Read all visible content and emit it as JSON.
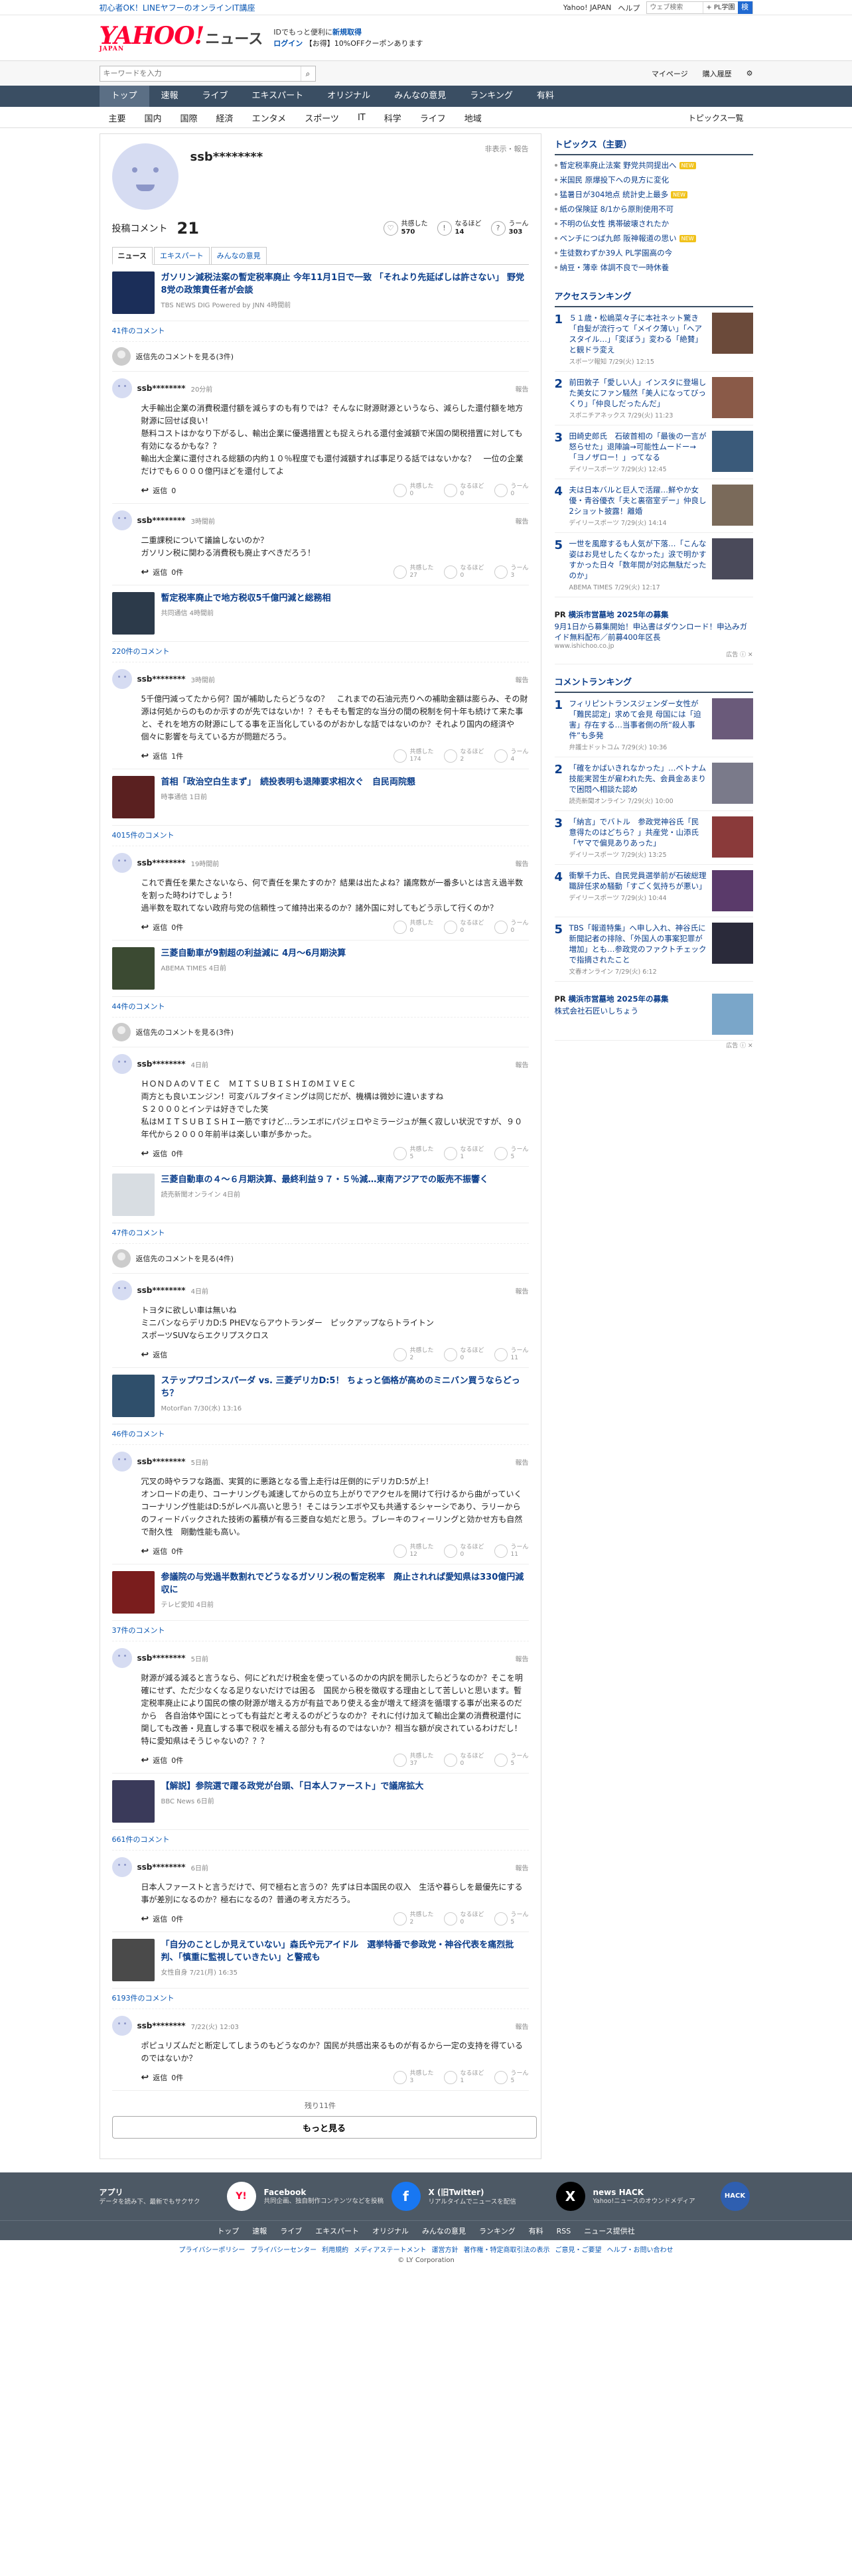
{
  "topbar": {
    "promo": "初心者OK！LINEヤフーのオンラインIT講座",
    "links": [
      "Yahoo! JAPAN",
      "ヘルプ"
    ],
    "search_placeholder": "ウェブ検索",
    "search_option": "+ PL学園",
    "search_button": "検"
  },
  "header": {
    "logo_text": "YAHOO!",
    "logo_sub": "JAPAN",
    "service": "ニュース",
    "msg1_prefix": "IDでもっと便利に",
    "msg1_link": "新規取得",
    "msg2_link": "ログイン",
    "msg2_suffix": "【お得】10%OFFクーポンあります"
  },
  "searchbar": {
    "placeholder": "キーワードを入力",
    "links": [
      "マイページ",
      "購入履歴"
    ]
  },
  "nav_main": [
    "トップ",
    "速報",
    "ライブ",
    "エキスパート",
    "オリジナル",
    "みんなの意見",
    "ランキング",
    "有料"
  ],
  "nav_sub": [
    "主要",
    "国内",
    "国際",
    "経済",
    "エンタメ",
    "スポーツ",
    "IT",
    "科学",
    "ライフ",
    "地域"
  ],
  "nav_sub_right": "トピックス一覧",
  "profile": {
    "name": "ssb********",
    "hide": "非表示・報告",
    "post_label": "投稿コメント",
    "post_count": "21",
    "reacts": [
      {
        "icon": "♡",
        "label": "共感した",
        "value": "570"
      },
      {
        "icon": "!",
        "label": "なるほど",
        "value": "14"
      },
      {
        "icon": "?",
        "label": "うーん",
        "value": "303"
      }
    ],
    "tabs": [
      "ニュース",
      "エキスパート",
      "みんなの意見"
    ]
  },
  "common": {
    "reply": "返信",
    "report": "報告",
    "react_labels": [
      "共感した",
      "なるほど",
      "うーん"
    ],
    "see_replies_prefix": "返信先のコメントを見る"
  },
  "articles": [
    {
      "title": "ガソリン減税法案の暫定税率廃止 今年11月1日で一致 「それより先延ばしは許さない」 野党8党の政策責任者が会談",
      "meta": "TBS NEWS DIG Powered by JNN 4時間前",
      "thumb_color": "#1b2e59",
      "comment_count": "41件のコメント",
      "replies_link": "返信先のコメントを見る(3件)",
      "comments": [
        {
          "name": "ssb********",
          "time": "20分前",
          "text": "大手輸出企業の消費税還付額を減らすのも有りでは？そんなに財源財源というなら、減らした還付額を地方財源に回せば良い！\n懸料コストはかなり下がるし、輸出企業に優遇措置とも捉えられる還付金減額で米国の関税措置に対しても有効になるかもな？？\n輸出大企業に還付される総額の内約１０％程度でも還付減額すれば事足りる話ではないかな？　一位の企業だけでも６０００億円ほどを還付してよ",
          "reply_count": "0",
          "reacts": [
            "0",
            "0",
            "0"
          ]
        },
        {
          "name": "ssb********",
          "time": "3時間前",
          "text": "二重課税について議論しないのか？\nガソリン税に関わる消費税も廃止すべきだろう！",
          "reply_count": "0件",
          "reacts": [
            "27",
            "0",
            "3"
          ]
        }
      ]
    },
    {
      "title": "暫定税率廃止で地方税収5千億円減と総務相",
      "meta": "共同通信 4時間前",
      "thumb_color": "#2c3a4a",
      "comment_count": "220件のコメント",
      "replies_link": "",
      "comments": [
        {
          "name": "ssb********",
          "time": "3時間前",
          "text": "5千億円減ってたから何？国が補助したらどうなの？　これまでの石油元売りへの補助金額は膨らみ、その財源は何処からのものか示すのが先ではないか！？そもそも暫定的な当分の間の税制を何十年も続けて来た事と、それを地方の財源にしてる事を正当化しているのがおかしな話ではないのか？それより国内の経済や個々に影響を与えている方が問題だろう。",
          "reply_count": "1件",
          "reacts": [
            "174",
            "2",
            "4"
          ]
        }
      ]
    },
    {
      "title": "首相「政治空白生まず」　続投表明も退陣要求相次ぐ　自民両院懇",
      "meta": "時事通信 1日前",
      "thumb_color": "#5a2020",
      "comment_count": "4015件のコメント",
      "replies_link": "",
      "comments": [
        {
          "name": "ssb********",
          "time": "19時間前",
          "text": "これで責任を果たさないなら、何で責任を果たすのか？結果は出たよね？議席数が一番多いとは言え過半数を割った時わけでしょう！\n過半数を取れてない政府与党の信頼性って維持出来るのか？諸外国に対してもどう示して行くのか？",
          "reply_count": "0件",
          "reacts": [
            "0",
            "0",
            "0"
          ]
        }
      ]
    },
    {
      "title": "三菱自動車が9割超の利益減に 4月〜6月期決算",
      "meta": "ABEMA TIMES 4日前",
      "thumb_color": "#3b4a32",
      "comment_count": "44件のコメント",
      "replies_link": "返信先のコメントを見る(3件)",
      "comments": [
        {
          "name": "ssb********",
          "time": "4日前",
          "text": "ＨＯＮＤＡのＶＴＥＣ　ＭＩＴＳＵＢＩＳＨＩのＭＩＶＥＣ\n両方とも良いエンジン！可変バルブタイミングは同じだが、機構は微妙に違いますね\nＳ２０００とインテは好きでした笑\n私はＭＩＴＳＵＢＩＳＨＩ一筋ですけど…ランエボにパジェロやミラージュが無く寂しい状況ですが、９０年代から２０００年前半は楽しい車が多かった。",
          "reply_count": "0件",
          "reacts": [
            "5",
            "1",
            "5"
          ]
        }
      ]
    },
    {
      "title": "三菱自動車の４～６月期決算、最終利益９７・５％減…東南アジアでの販売不振響く",
      "meta": "読売新聞オンライン 4日前",
      "thumb_color": "#d8dde2",
      "comment_count": "47件のコメント",
      "replies_link": "返信先のコメントを見る(4件)",
      "comments": [
        {
          "name": "ssb********",
          "time": "4日前",
          "text": "トヨタに欲しい車は無いね\nミニバンならデリカD:5 PHEVならアウトランダー　ピックアップならトライトン\nスポーツSUVならエクリプスクロス",
          "reply_count": "",
          "reacts": [
            "2",
            "0",
            "11"
          ]
        }
      ]
    },
    {
      "title": "ステップワゴンスパーダ vs. 三菱デリカD:5！ ちょっと価格が高めのミニバン買うならどっち？",
      "meta": "MotorFan 7/30(水) 13:16",
      "thumb_color": "#2f4f6b",
      "comment_count": "46件のコメント",
      "replies_link": "",
      "comments": [
        {
          "name": "ssb********",
          "time": "5日前",
          "text": "冗叉の時やラフな路面、実質的に悪路となる雪上走行は圧倒的にデリカD:5が上！\nオンロードの走り、コーナリングも減速してからの立ち上がりでアクセルを開けて行けるから曲がっていくコーナリング性能はD:5がレベル高いと思う！そこはランエボや又も共通するシャーシであり、ラリーからのフィードバックされた技術の蓄積が有る三菱自な処だと思う。ブレーキのフィーリングと効かせ方も自然で耐久性　剛動性能も高い。",
          "reply_count": "0件",
          "reacts": [
            "12",
            "0",
            "11"
          ]
        }
      ]
    },
    {
      "title": "参議院の与党過半数割れでどうなるガソリン税の暫定税率　廃止されれば愛知県は330億円減収に",
      "meta": "テレビ愛知 4日前",
      "thumb_color": "#7a1d1d",
      "comment_count": "37件のコメント",
      "replies_link": "",
      "comments": [
        {
          "name": "ssb********",
          "time": "5日前",
          "text": "財源が減る減ると言うなら、何にどれだけ税金を使っているのかの内訳を開示したらどうなのか？そこを明確にせず、ただ少なくなる足りないだけでは困る　国民から税を徴収する理由として苦しいと思います。暫定税率廃止により国民の懐の財源が増える方が有益であり使える金が増えて経済を循環する事が出来るのだから　各自治体や国にとっても有益だと考えるのがどうなのか？それに付け加えて輸出企業の消費税還付に関しても改善・見直しする事で税収を補える部分も有るのではないか？相当な額が戻されているわけだし！特に愛知県はそうじゃないの？？？",
          "reply_count": "0件",
          "reacts": [
            "37",
            "0",
            "5"
          ]
        }
      ]
    },
    {
      "title": "【解説】参院選で躍る政党が台頭、「日本人ファースト」で議席拡大",
      "meta": "BBC News 6日前",
      "thumb_color": "#3a3a5a",
      "comment_count": "661件のコメント",
      "replies_link": "",
      "comments": [
        {
          "name": "ssb********",
          "time": "6日前",
          "text": "日本人ファーストと言うだけで、何で極右と言うの？先ずは日本国民の収入　生活や暮らしを最優先にする事が差別になるのか？極右になるの？普通の考え方だろう。",
          "reply_count": "0件",
          "reacts": [
            "2",
            "0",
            "5"
          ]
        }
      ]
    },
    {
      "title": "「自分のことしか見えていない」森氏や元アイドル　選挙特番で参政党・神谷代表を痛烈批判、「慎重に監視していきたい」と警戒も",
      "meta": "女性自身 7/21(月) 16:35",
      "thumb_color": "#4a4a4a",
      "comment_count": "6193件のコメント",
      "replies_link": "",
      "comments": [
        {
          "name": "ssb********",
          "time": "7/22(火) 12:03",
          "text": "ポピュリズムだと断定してしまうのもどうなのか？国民が共感出来るものが有るから一定の支持を得ているのではないか？",
          "reply_count": "0件",
          "reacts": [
            "3",
            "1",
            "5"
          ]
        }
      ]
    }
  ],
  "more": {
    "rest": "残り11件",
    "button": "もっと見る"
  },
  "topics": {
    "heading": "トピックス（主要）",
    "items": [
      {
        "text": "暫定税率廃止法案 野党共同提出へ",
        "badge": "NEW"
      },
      {
        "text": "米国民 原爆投下への見方に変化",
        "badge": ""
      },
      {
        "text": "猛暑日が304地点 統計史上最多",
        "badge": "NEW"
      },
      {
        "text": "紙の保険証 8/1から原則使用不可",
        "badge": ""
      },
      {
        "text": "不明の仏女性 携帯破壊されたか",
        "badge": ""
      },
      {
        "text": "ベンチにつば九郎 阪神報道の思い",
        "badge": "NEW"
      },
      {
        "text": "生徒数わずか39人 PL学園高の今",
        "badge": ""
      },
      {
        "text": "納豆・薄幸 体調不良で一時休養",
        "badge": ""
      }
    ]
  },
  "access_ranking": {
    "heading": "アクセスランキング",
    "items": [
      {
        "n": "1",
        "text": "５１歳・松嶋菜々子に本社ネット驚き「自髪が流行って「メイク薄い」「ヘアスタイル…」「変ぼう」変わる「絶賛」と観ドラ変え",
        "meta": "スポーツ報知 7/29(火) 12:15",
        "color": "#6b4a3a"
      },
      {
        "n": "2",
        "text": "前田敦子「愛しい人」インスタに登場した美女にファン騒然「美人になってびっくり」「仲良しだったんだ」",
        "meta": "スポニチアネックス 7/29(火) 11:23",
        "color": "#8a5a48"
      },
      {
        "n": "3",
        "text": "田崎史郎氏　石破首相の「最後の一言が怒らせた」退陣論→可能性ムードー→「ヨノザロー！」ってなる",
        "meta": "デイリースポーツ 7/29(火) 12:45",
        "color": "#3a5a7a"
      },
      {
        "n": "4",
        "text": "夫は日本バルと巨人で活躍…鮮やか女優・青谷優衣「夫と裏宿室デー」仲良し2ショット披露！離婚",
        "meta": "デイリースポーツ 7/29(火) 14:14",
        "color": "#7a6a5a"
      },
      {
        "n": "5",
        "text": "一世を風靡するも人気が下落…「こんな姿はお見せしたくなかった」涙で明かすすかった日々「数年間が対応無駄だったのか」",
        "meta": "ABEMA TIMES 7/29(火) 12:17",
        "color": "#4a4a5a"
      }
    ]
  },
  "pr1": {
    "label": "PR",
    "title": "横浜市営墓地 2025年の募集",
    "desc": "9月1日から募集開始！申込書はダウンロード！申込みガイド無料配布／前募400年区長",
    "url": "www.ishichoo.co.jp",
    "ad": "広告 ⓘ ✕"
  },
  "comment_ranking": {
    "heading": "コメントランキング",
    "items": [
      {
        "n": "1",
        "text": "フィリピントランスジェンダー女性が「難民認定」求めて会見 母国には「迫害」存在する…当事者側の所“殺人事件”も多発",
        "meta": "弁護士ドットコム 7/29(火) 10:36",
        "color": "#6a5a7a"
      },
      {
        "n": "2",
        "text": "「確をかばいきれなかった」…ベトナム技能実習生が雇われた先、会員金あまりで困悶へ相談た認め",
        "meta": "読売新聞オンライン 7/29(火) 10:00",
        "color": "#7a7a8a"
      },
      {
        "n": "3",
        "text": "「納言」でバトル　参政党神谷氏「民意得たのはどちら？」共産党・山添氏「ヤマで偏見ありあった」",
        "meta": "デイリースポーツ 7/29(火) 13:25",
        "color": "#8a3a3a"
      },
      {
        "n": "4",
        "text": "衝撃千力氏、自民党員選挙前が石破総理職辞任求め騒動「すごく気持ちが悪い」",
        "meta": "デイリースポーツ 7/29(火) 10:44",
        "color": "#5a3a6a"
      },
      {
        "n": "5",
        "text": "TBS「報道特集」へ申し入れ、神谷氏に新聞記者の排除、「外国人の事案犯罪が増加」とも…参政党のファクトチェックで指摘されたこと",
        "meta": "文春オンライン 7/29(火) 6:12",
        "color": "#2a2a3a"
      }
    ]
  },
  "pr2": {
    "label": "PR",
    "title": "横浜市営墓地 2025年の募集",
    "desc": "株式会社石匠いしちょう",
    "url": "",
    "ad": "広告 ⓘ ✕"
  },
  "apps": [
    {
      "name": "アプリ",
      "desc": "データを読み下、最新でもサクサク",
      "icon": "Y!",
      "color": "#ffffff"
    },
    {
      "name": "Facebook",
      "desc": "共同企画、独自制作コンテンツなどを投稿",
      "icon": "f",
      "color": "#1877f2"
    },
    {
      "name": "X (旧Twitter)",
      "desc": "リアルタイムでニュースを配信",
      "icon": "X",
      "color": "#000000"
    },
    {
      "name": "news HACK",
      "desc": "Yahoo!ニュースのオウンドメディア",
      "icon": "HACK",
      "color": "#2f5fb0"
    }
  ],
  "footer_nav": [
    "トップ",
    "速報",
    "ライブ",
    "エキスパート",
    "オリジナル",
    "みんなの意見",
    "ランキング",
    "有料",
    "RSS",
    "ニュース提供社"
  ],
  "footer_links": [
    "プライバシーポリシー",
    "プライバシーセンター",
    "利用規約",
    "メディアステートメント",
    "運営方針",
    "著作権・特定商取引法の表示",
    "ご意見・ご要望",
    "ヘルプ・お問い合わせ"
  ],
  "copyright": "© LY Corporation"
}
